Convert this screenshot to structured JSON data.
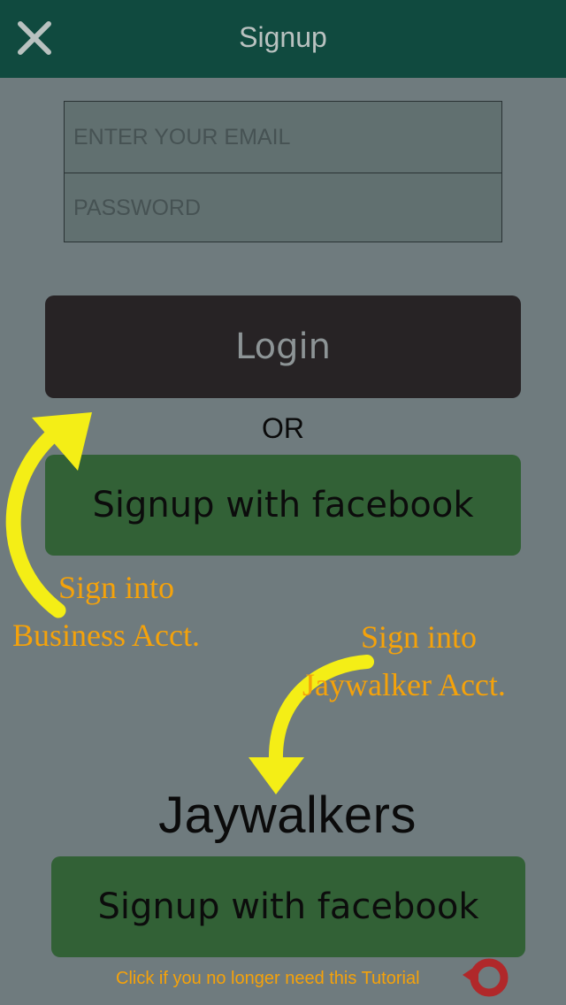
{
  "header": {
    "title": "Signup",
    "close_icon": "close-icon"
  },
  "form": {
    "email_placeholder": "ENTER YOUR EMAIL",
    "email_value": "",
    "password_placeholder": "PASSWORD",
    "password_value": ""
  },
  "login_button": {
    "label": "Login"
  },
  "separator": {
    "label": "OR"
  },
  "business_facebook_button": {
    "label": "Signup with facebook"
  },
  "annotations": {
    "business_line1": "Sign into",
    "business_line2": "Business Acct.",
    "jaywalker_line1": "Sign into",
    "jaywalker_line2": "Jaywalker Acct."
  },
  "brand": {
    "name": "Jaywalkers"
  },
  "jaywalker_facebook_button": {
    "label": "Signup with facebook"
  },
  "footer": {
    "tutorial_text": "Click if you no longer need this Tutorial",
    "refresh_icon": "refresh-icon"
  },
  "colors": {
    "header_bg": "#104a3f",
    "page_bg": "#6f7b7e",
    "login_bg": "#272325",
    "facebook_bg": "#326136",
    "annotation_text": "#f5a20a",
    "arrow": "#f4ee16"
  }
}
